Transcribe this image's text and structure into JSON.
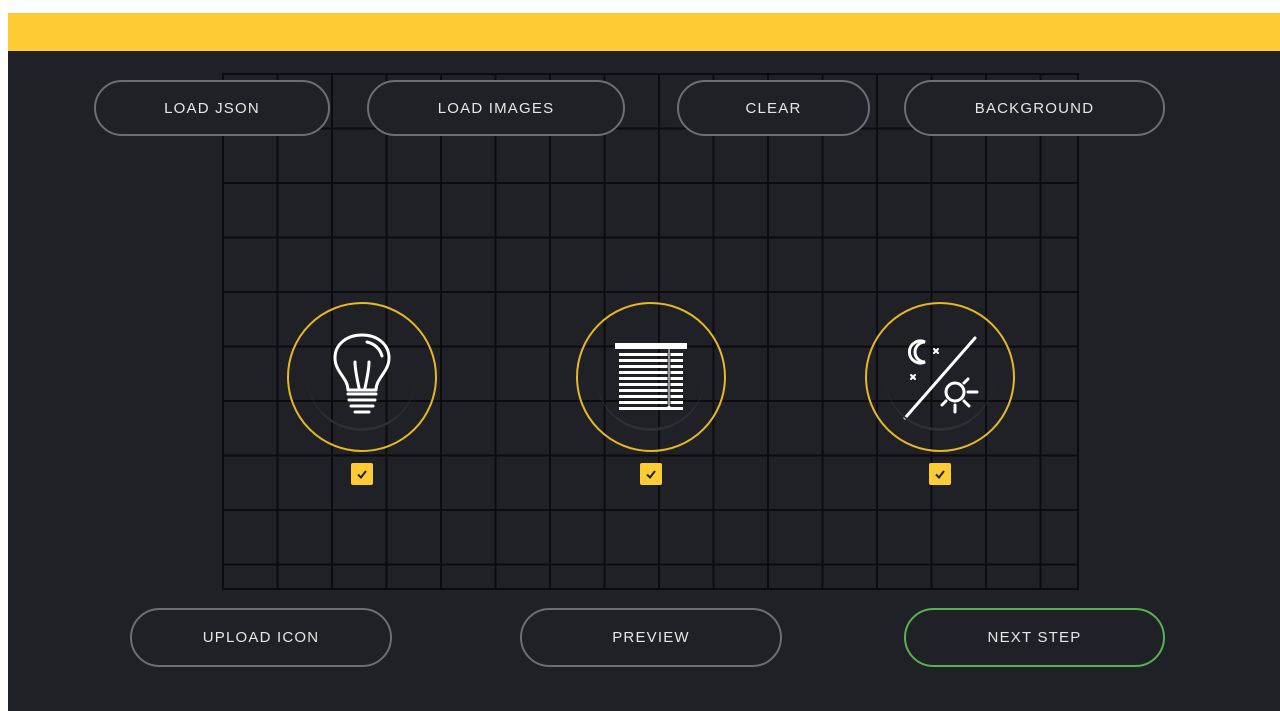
{
  "toolbar": {
    "load_json": "LOAD JSON",
    "load_images": "LOAD IMAGES",
    "clear": "CLEAR",
    "background": "BACKGROUND"
  },
  "footer": {
    "upload_icon": "UPLOAD ICON",
    "preview": "PREVIEW",
    "next_step": "NEXT STEP"
  },
  "icons": [
    {
      "name": "light-bulb-icon",
      "checked": true
    },
    {
      "name": "window-blinds-icon",
      "checked": true
    },
    {
      "name": "day-night-icon",
      "checked": true
    }
  ],
  "colors": {
    "accent": "#FDCB34",
    "background": "#202126",
    "ring": "#E6B822",
    "next_border": "#58b04f",
    "button_border": "#6b6e77"
  }
}
